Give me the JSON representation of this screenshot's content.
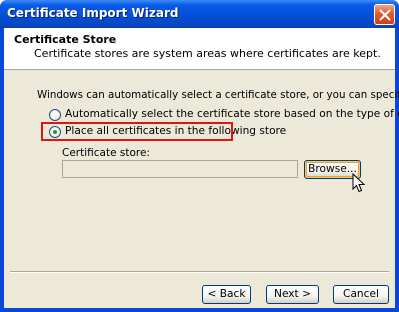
{
  "window": {
    "title": "Certificate Import Wizard"
  },
  "header": {
    "title": "Certificate Store",
    "subtitle": "Certificate stores are system areas where certificates are kept."
  },
  "body": {
    "intro": "Windows can automatically select a certificate store, or you can specify a location for",
    "options": [
      {
        "label": "Automatically select the certificate store based on the type of certificate",
        "selected": false
      },
      {
        "label": "Place all certificates in the following store",
        "selected": true
      }
    ],
    "store": {
      "label": "Certificate store:",
      "value": "",
      "browse_label": "Browse..."
    },
    "highlight_color": "#e01414"
  },
  "footer": {
    "back_label": "< Back",
    "next_label": "Next >",
    "cancel_label": "Cancel"
  },
  "colors": {
    "titlebar": "#0550d8",
    "dialog_bg": "#ece9d8",
    "close_button": "#e25c33"
  }
}
